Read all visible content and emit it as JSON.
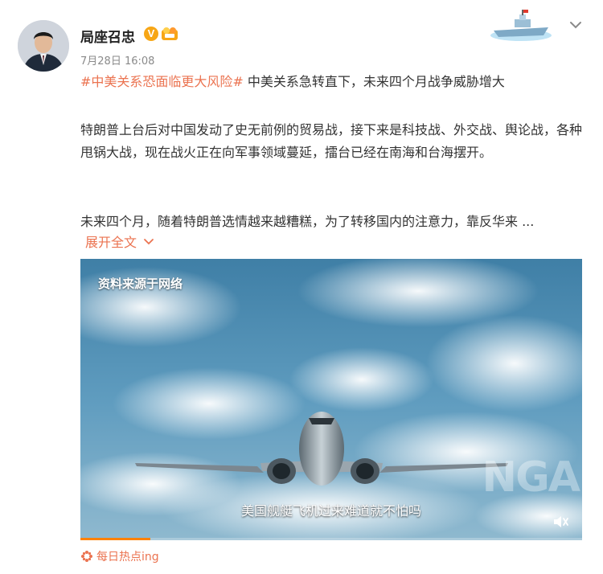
{
  "post": {
    "author": "局座召忠",
    "verified_badge": "V",
    "timestamp": "7月28日 16:08",
    "topic_tag": "#中美关系恐面临更大风险#",
    "headline": "中美关系急转直下，未来四个月战争威胁增大",
    "paragraph2": "特朗普上台后对中国发动了史无前例的贸易战，接下来是科技战、外交战、舆论战，各种甩锅大战，现在战火正在向军事领域蔓延，擂台已经在南海和台海摆开。",
    "paragraph3": "未来四个月，随着特朗普选情越来越糟糕，为了转移国内的注意力，靠反华来 ...",
    "expand_label": "展开全文",
    "icons": {
      "verified": "verified-v-badge",
      "level": "level-badge-icon",
      "collapse": "chevron-down-icon",
      "expand": "chevron-down-icon",
      "mute": "mute-icon",
      "hot": "flower-icon"
    },
    "accent_color": "#eb7350"
  },
  "video": {
    "source_label": "资料来源于网络",
    "subtitle": "美国舰艇飞机过来难道就不怕吗",
    "watermark": "NGA",
    "progress": 0.14,
    "progress_color": "#ff8200"
  },
  "footer": {
    "hot_label": "每日热点ing"
  }
}
